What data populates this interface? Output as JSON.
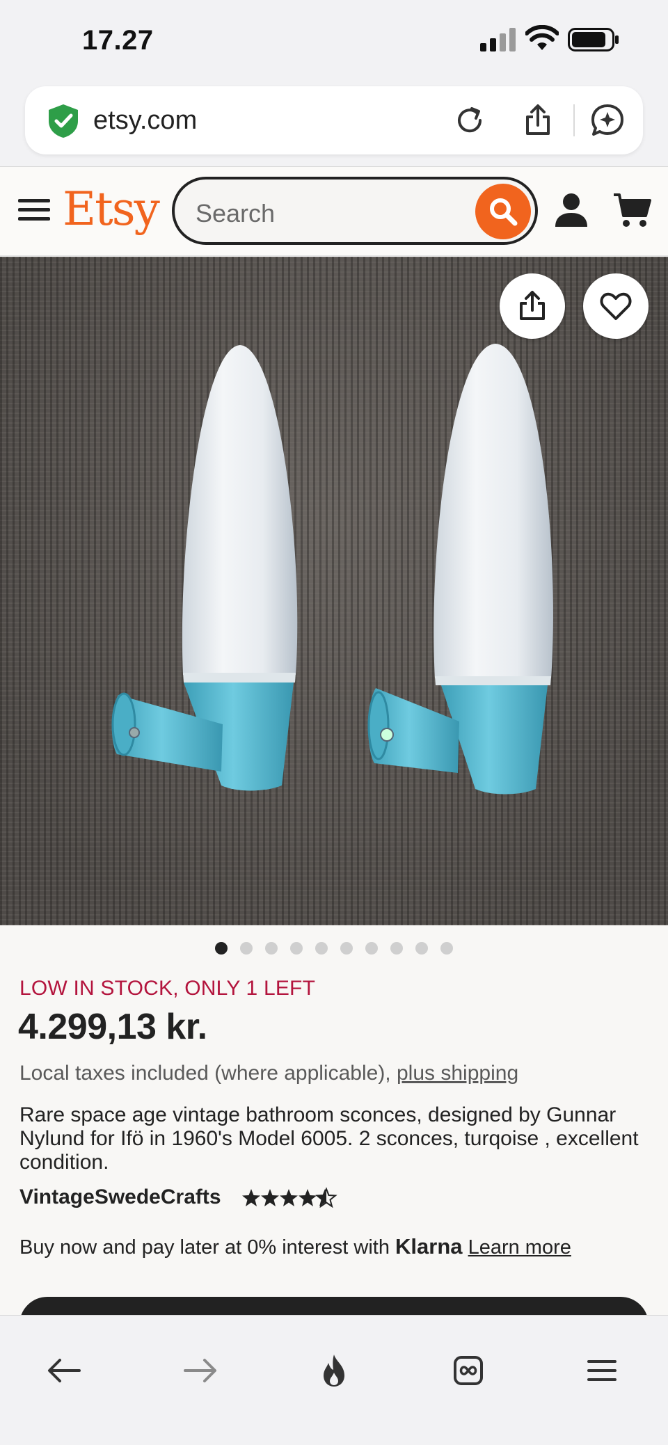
{
  "status_bar": {
    "time": "17.27"
  },
  "browser": {
    "url": "etsy.com"
  },
  "etsy_header": {
    "logo": "Etsy",
    "search_placeholder": "Search"
  },
  "product": {
    "image_count": 10,
    "active_image_index": 0,
    "stock_notice": "LOW IN STOCK, ONLY 1 LEFT",
    "price": "4.299,13 kr.",
    "taxes_prefix": "Local taxes included (where applicable),",
    "shipping_link": "plus shipping",
    "description": "Rare space age vintage bathroom sconces, designed by Gunnar Nylund for Ifö in 1960's Model 6005. 2 sconces, turqoise , excellent condition.",
    "seller": "VintageSwedeCrafts",
    "rating": 4.5,
    "klarna_prefix": "Buy now and pay later at 0% interest with",
    "klarna_brand": "Klarna",
    "klarna_link": "Learn more"
  },
  "colors": {
    "brand_orange": "#f1641e",
    "stock_red": "#b3143d",
    "lamp_turquoise": "#5bb8cf"
  },
  "icons": {
    "status": [
      "signal-icon",
      "wifi-icon",
      "battery-icon"
    ],
    "url_bar": [
      "shield-check-icon",
      "reload-icon",
      "share-icon",
      "ai-chat-icon"
    ],
    "header": [
      "hamburger-menu-icon",
      "search-icon",
      "user-icon",
      "cart-icon"
    ],
    "photo": [
      "share-icon",
      "heart-icon"
    ],
    "toolbar": [
      "back-arrow-icon",
      "forward-arrow-icon",
      "flame-icon",
      "tabs-icon",
      "menu-icon"
    ]
  }
}
